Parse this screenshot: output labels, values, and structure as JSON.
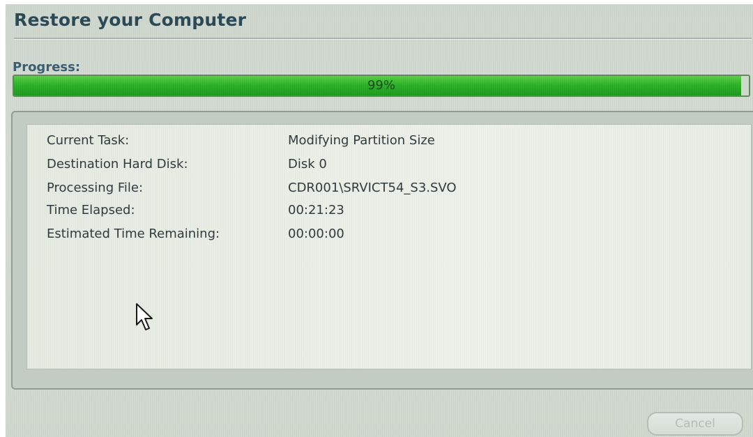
{
  "window": {
    "title": "Restore your Computer"
  },
  "progress": {
    "label": "Progress:",
    "value": 0.99,
    "text": "99%",
    "fill_color": "#2fb52b"
  },
  "details": {
    "rows": [
      {
        "label": "Current Task:",
        "value": "Modifying Partition Size"
      },
      {
        "label": "Destination Hard Disk:",
        "value": "Disk 0"
      },
      {
        "label": "Processing File:",
        "value": "CDR001\\SRVICT54_S3.SVO"
      },
      {
        "label": "Time Elapsed:",
        "value": "00:21:23"
      },
      {
        "label": "Estimated Time Remaining:",
        "value": "00:00:00"
      }
    ]
  },
  "buttons": {
    "cancel_label": "Cancel",
    "cancel_enabled": false
  },
  "cursor": {
    "icon": "mouse-pointer-icon"
  },
  "colors": {
    "title_text": "#2c4a56",
    "progress_label_text": "#3b5e72",
    "background": "#d4dcd2"
  }
}
